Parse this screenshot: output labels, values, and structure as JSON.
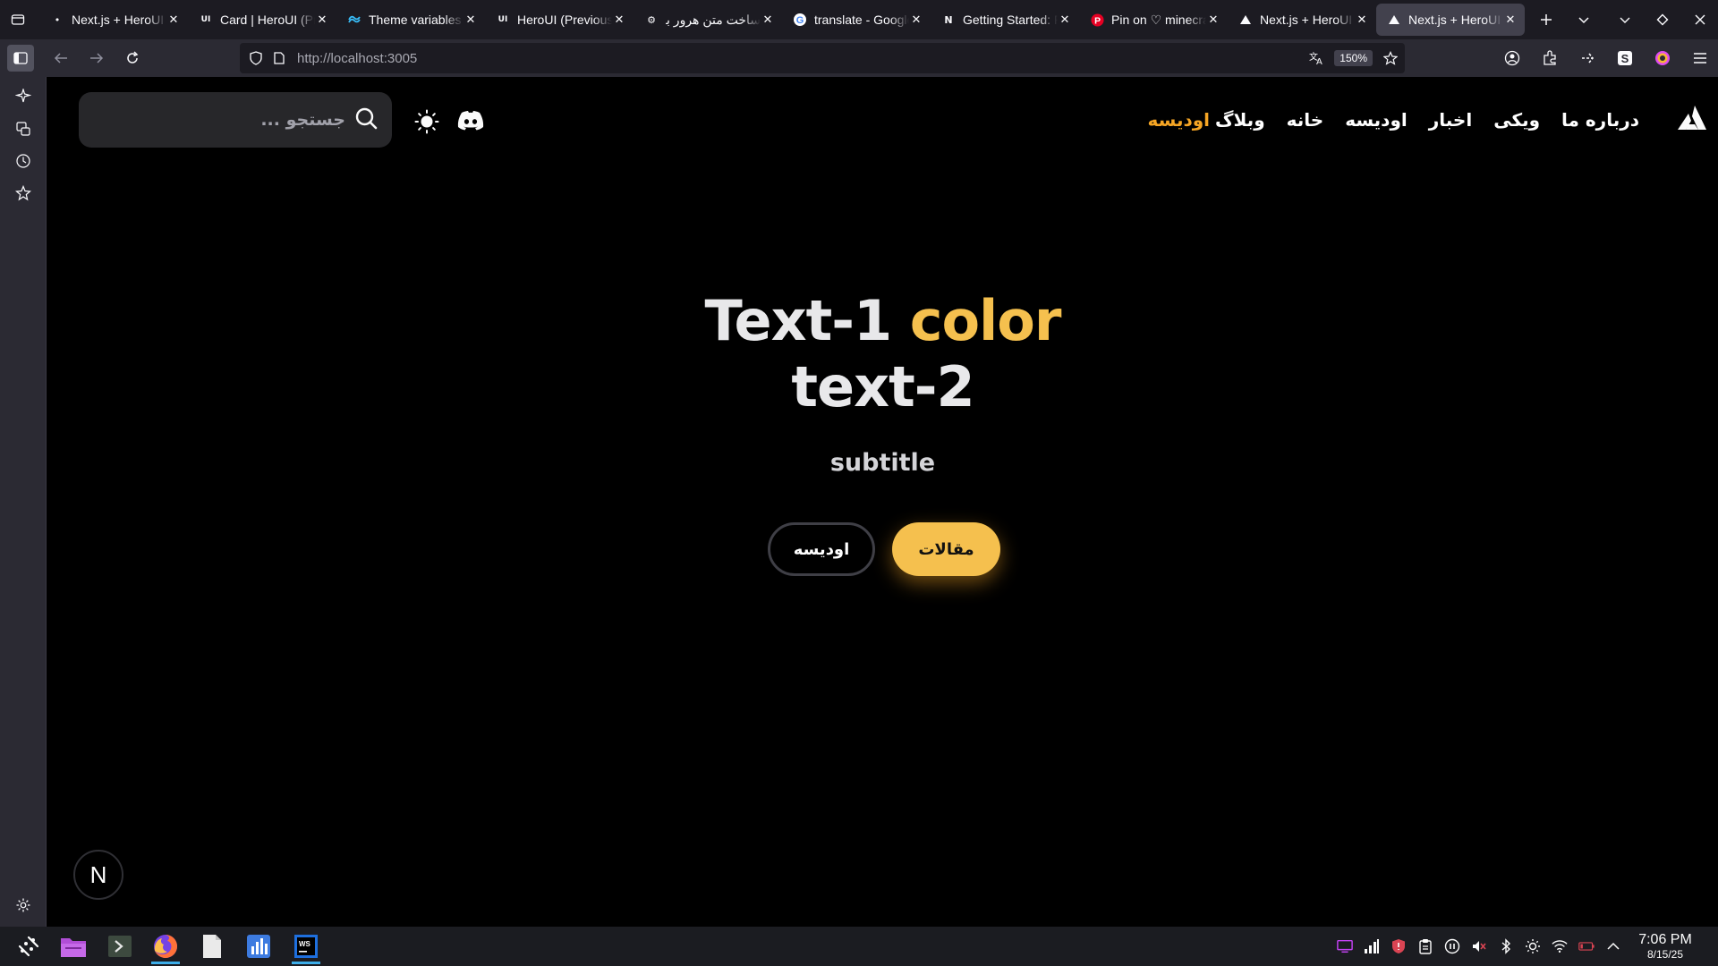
{
  "browser": {
    "tabs": [
      {
        "title": "Next.js + HeroUI",
        "favicon": "dot"
      },
      {
        "title": "Card | HeroUI (Pr",
        "favicon": "UI"
      },
      {
        "title": "Theme variables",
        "favicon": "tailwind"
      },
      {
        "title": "HeroUI (Previousl",
        "favicon": "UI"
      },
      {
        "title": "ساخت متن هرور با",
        "favicon": "gear"
      },
      {
        "title": "translate - Google",
        "favicon": "G"
      },
      {
        "title": "Getting Started: P",
        "favicon": "N"
      },
      {
        "title": "Pin on ♡ minecra",
        "favicon": "P"
      },
      {
        "title": "Next.js + HeroUI",
        "favicon": "triangle"
      },
      {
        "title": "Next.js + HeroUI",
        "favicon": "triangle",
        "active": true
      }
    ],
    "url": "http://localhost:3005",
    "zoom": "150%"
  },
  "site": {
    "search_placeholder": "جستجو ...",
    "nav_items": [
      "درباره ما",
      "ویکی",
      "اخبار",
      "اودیسه",
      "خانه"
    ],
    "brand_main": "وبلاگ",
    "brand_accent": "اودیسه",
    "hero_line1_a": "Text-1",
    "hero_line1_b": "color",
    "hero_line2": "text-2",
    "subtitle": "subtitle",
    "btn_primary": "مقالات",
    "btn_secondary": "اودیسه",
    "badge": "N",
    "accent_color": "#f5c04e"
  },
  "taskbar": {
    "time": "7:06 PM",
    "date": "8/15/25"
  }
}
